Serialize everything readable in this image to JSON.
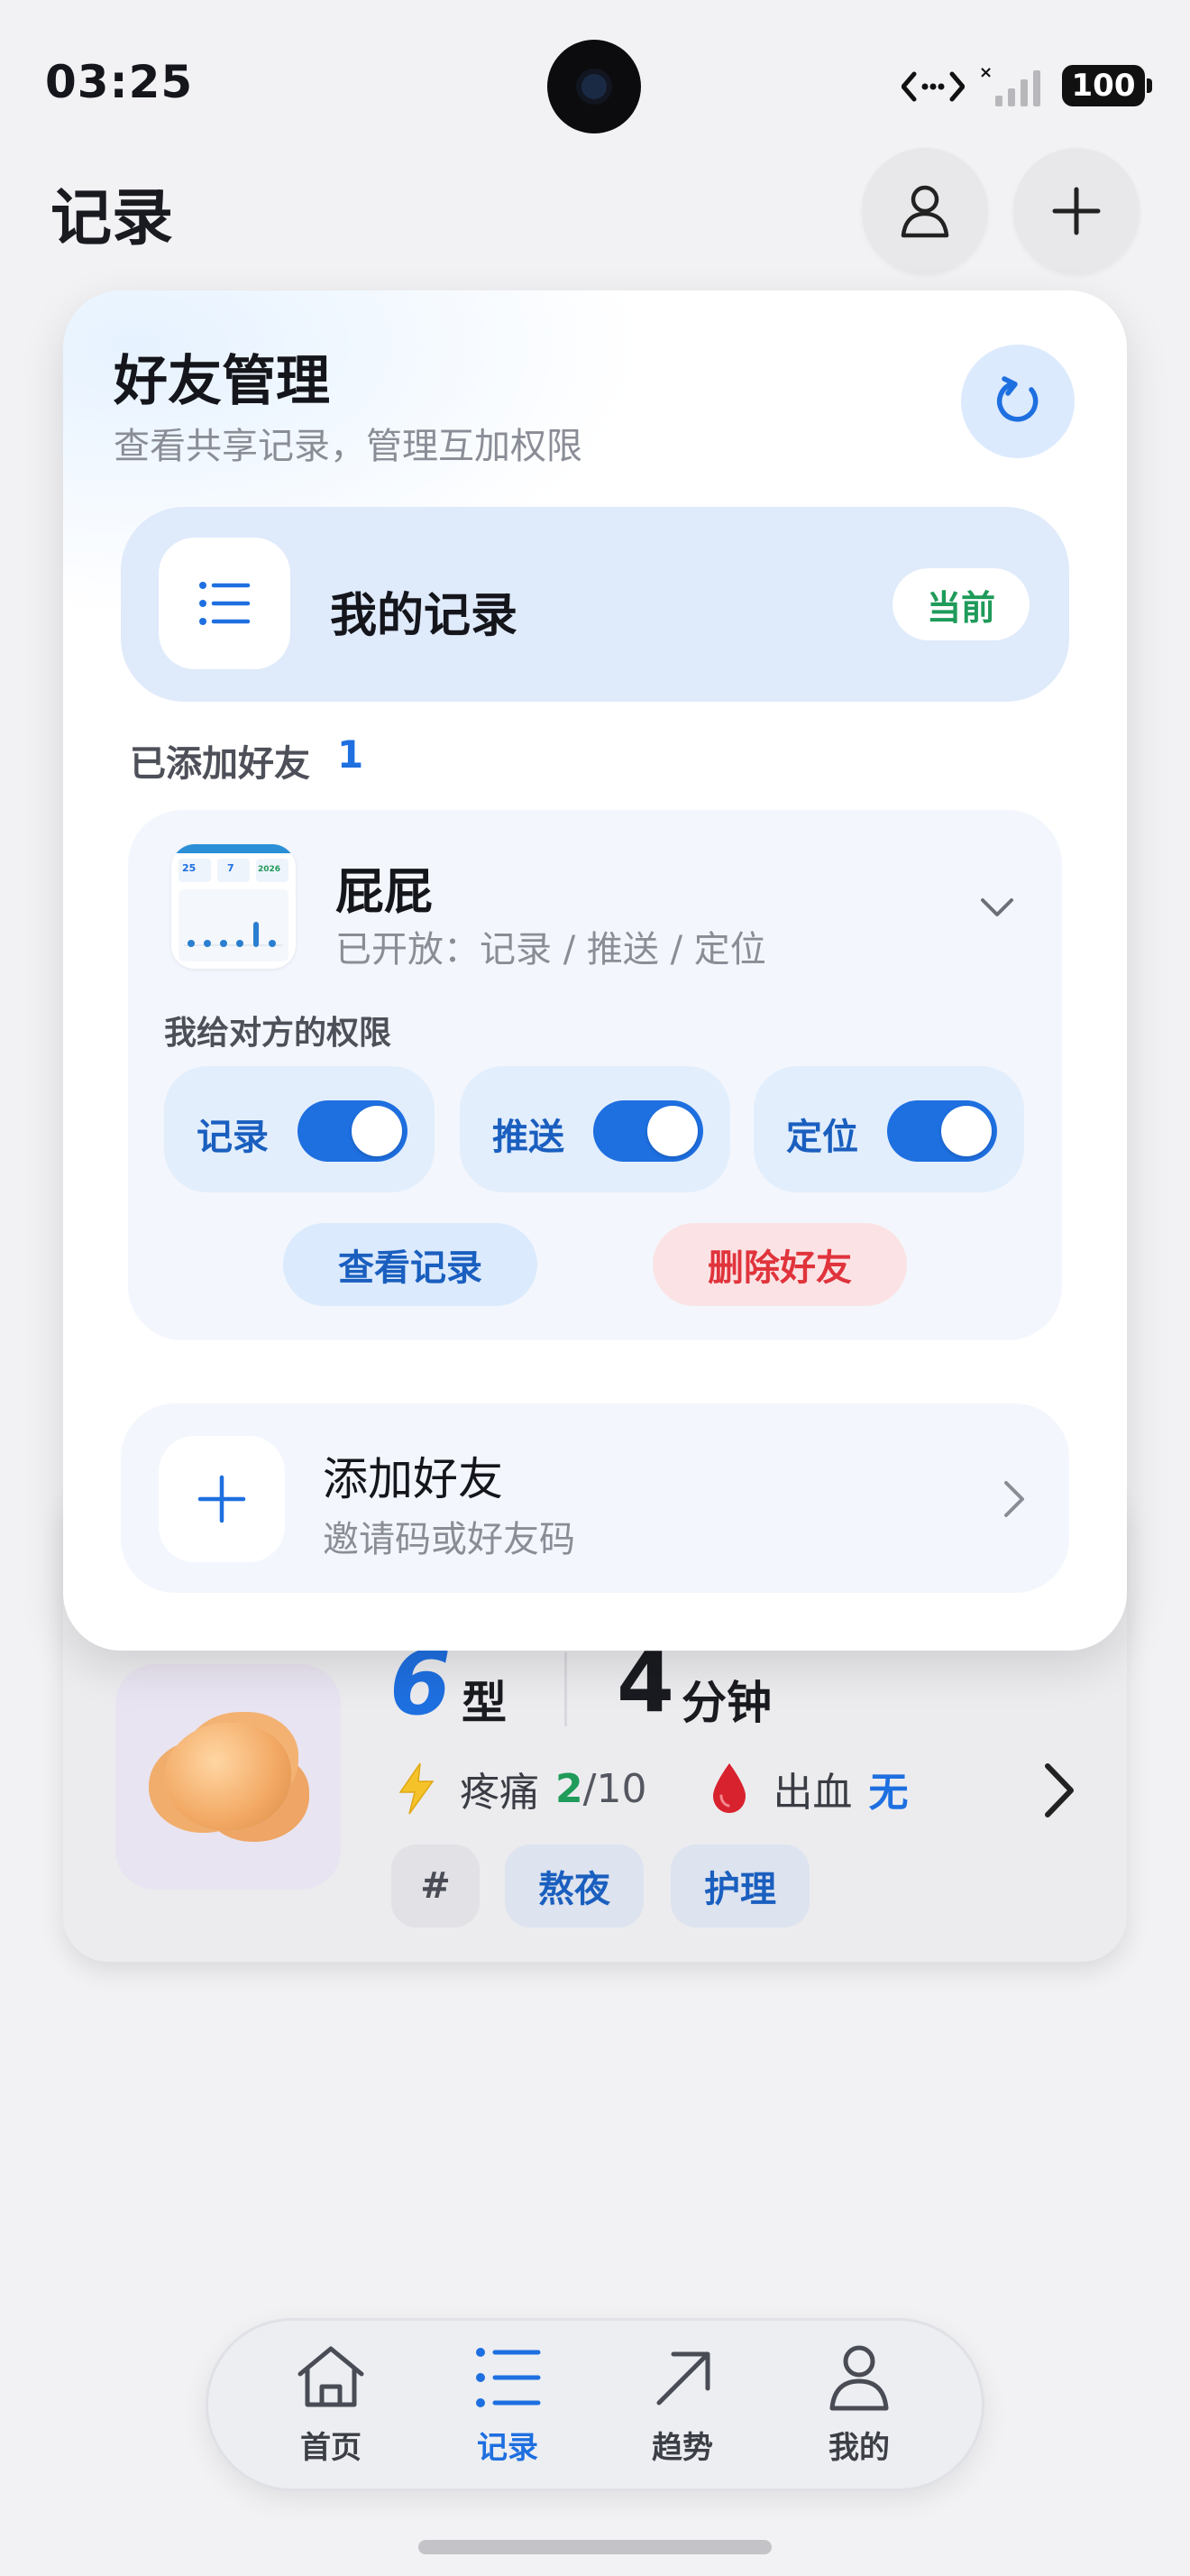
{
  "status": {
    "time": "03:25",
    "battery": "100",
    "icons": [
      "location-icon",
      "cellular-signal-icon",
      "battery-icon"
    ]
  },
  "header": {
    "title": "记录",
    "icons": [
      "profile-icon",
      "plus-icon"
    ]
  },
  "friend_panel": {
    "title": "好友管理",
    "subtitle": "查看共享记录，管理互加权限",
    "my_record": {
      "label": "我的记录",
      "badge": "当前"
    },
    "added": {
      "label": "已添加好友",
      "count": "1"
    },
    "friend": {
      "name": "屁屁",
      "open_text": "已开放：记录 / 推送 / 定位",
      "permissions_title": "我给对方的权限",
      "permissions": [
        {
          "label": "记录",
          "enabled": true
        },
        {
          "label": "推送",
          "enabled": true
        },
        {
          "label": "定位",
          "enabled": true
        }
      ],
      "view_button": "查看记录",
      "delete_button": "删除好友",
      "avatar_numbers": [
        "25",
        "7",
        "2026"
      ]
    },
    "add_friend": {
      "title": "添加好友",
      "subtitle": "邀请码或好友码"
    }
  },
  "record_card": {
    "type_value": "6",
    "type_unit": "型",
    "duration_value": "4",
    "duration_unit": "分钟",
    "pain_label": "疼痛",
    "pain_value": "2",
    "pain_max": "/10",
    "bleeding_label": "出血",
    "bleeding_value": "无",
    "tags": [
      "#",
      "熬夜",
      "护理"
    ]
  },
  "tabbar": {
    "tabs": [
      {
        "label": "首页",
        "icon": "home-icon",
        "active": false
      },
      {
        "label": "记录",
        "icon": "list-icon",
        "active": true
      },
      {
        "label": "趋势",
        "icon": "trend-arrow-icon",
        "active": false
      },
      {
        "label": "我的",
        "icon": "person-icon",
        "active": false
      }
    ]
  },
  "colors": {
    "accent": "#1e6fe0",
    "success": "#1f9b5a",
    "danger": "#e0343c",
    "background": "#f2f2f4"
  }
}
